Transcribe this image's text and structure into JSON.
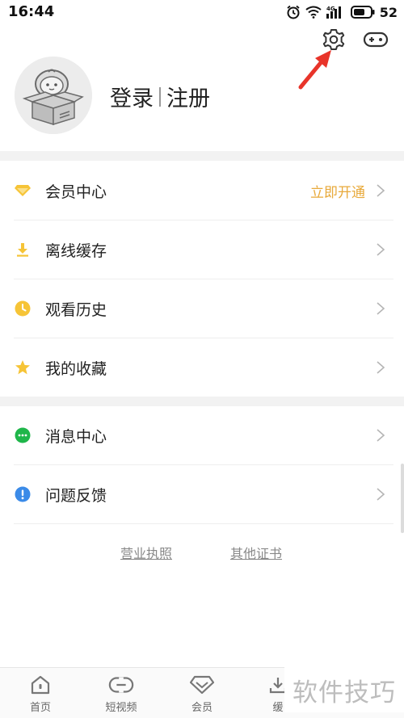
{
  "status_bar": {
    "time": "16:44",
    "battery": "52",
    "network": "4G"
  },
  "top_icons": [
    "gear-icon",
    "gamepad-icon"
  ],
  "profile": {
    "login": "登录",
    "register": "注册"
  },
  "menu_group_1": [
    {
      "label": "会员中心",
      "extra": "立即开通",
      "icon": "diamond-icon"
    },
    {
      "label": "离线缓存",
      "extra": "",
      "icon": "download-icon"
    },
    {
      "label": "观看历史",
      "extra": "",
      "icon": "clock-icon"
    },
    {
      "label": "我的收藏",
      "extra": "",
      "icon": "star-icon"
    }
  ],
  "menu_group_2": [
    {
      "label": "消息中心",
      "icon": "chat-bubble-icon"
    },
    {
      "label": "问题反馈",
      "icon": "exclamation-icon"
    }
  ],
  "links": {
    "business_license": "营业执照",
    "other_certificates": "其他证书"
  },
  "bottom_nav": [
    {
      "label": "首页",
      "icon": "home-icon"
    },
    {
      "label": "短视频",
      "icon": "link-icon"
    },
    {
      "label": "会员",
      "icon": "diamond-outline-icon"
    },
    {
      "label": "缓",
      "icon": "download-icon"
    }
  ],
  "watermark": "软件技巧",
  "colors": {
    "accent_gold": "#e8a93a",
    "icon_yellow": "#f6c437",
    "message_green": "#1fb64a",
    "feedback_blue": "#3b8be8",
    "arrow_red": "#e8342a"
  }
}
